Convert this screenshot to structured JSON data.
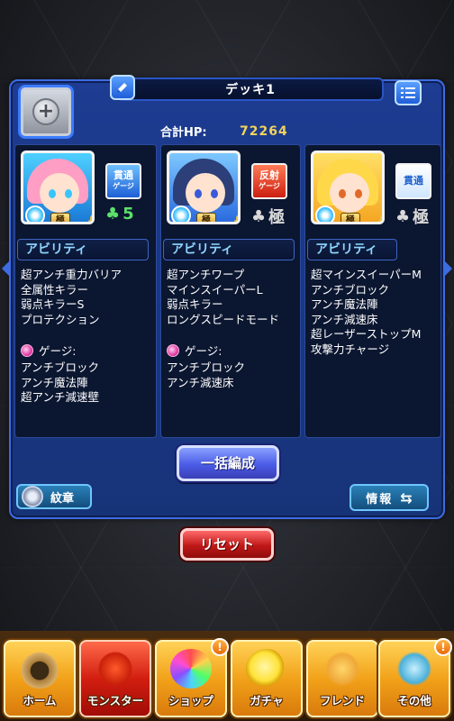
{
  "deck": {
    "title": "デッキ1",
    "hp_label": "合計HP:",
    "hp_value": "72264"
  },
  "slots": [
    {
      "gimmick_tag": {
        "line1": "貫通",
        "line2": "ゲージ",
        "style": "blue"
      },
      "luck": "5",
      "luck_kind": "green",
      "rank_badge": "極",
      "ability_heading": "アビリティ",
      "abilities": [
        "超アンチ重力バリア",
        "全属性キラー",
        "弱点キラーS",
        "プロテクション"
      ],
      "gauge_label": "ゲージ:",
      "gauge_abilities": [
        "アンチブロック",
        "アンチ魔法陣",
        "超アンチ減速壁"
      ]
    },
    {
      "gimmick_tag": {
        "line1": "反射",
        "line2": "ゲージ",
        "style": "red"
      },
      "luck": "極",
      "luck_kind": "grey",
      "rank_badge": "極",
      "ability_heading": "アビリティ",
      "abilities": [
        "超アンチワープ",
        "マインスイーパーL",
        "弱点キラー",
        "ロングスピードモード"
      ],
      "gauge_label": "ゲージ:",
      "gauge_abilities": [
        "アンチブロック",
        "アンチ減速床"
      ]
    },
    {
      "gimmick_tag": {
        "line1": "貫通",
        "line2": "",
        "style": "white"
      },
      "luck": "極",
      "luck_kind": "grey",
      "rank_badge": "極",
      "ability_heading": "アビリティ",
      "abilities": [
        "超マインスイーパーM",
        "アンチブロック",
        "アンチ魔法陣",
        "アンチ減速床",
        "超レーザーストップM",
        "攻撃力チャージ"
      ]
    }
  ],
  "buttons": {
    "bulk": "一括編成",
    "emblem": "紋章",
    "info": "情報",
    "reset": "リセット"
  },
  "nav": {
    "home": "ホーム",
    "monster": "モンスター",
    "shop": "ショップ",
    "gacha": "ガチャ",
    "friend": "フレンド",
    "other": "その他",
    "badge": "!"
  },
  "colors": {
    "panel": "#1d3c92",
    "hp_value": "#f2d35a",
    "ability_heading": "#8fd6ff",
    "luck_green": "#5ce06b"
  },
  "icons": {
    "edit": "pencil-icon",
    "list": "list-icon",
    "add": "plus-icon",
    "lock": "lock-icon",
    "clover": "clover-icon",
    "gauge": "gauge-icon",
    "swap": "swap-arrows-icon"
  }
}
